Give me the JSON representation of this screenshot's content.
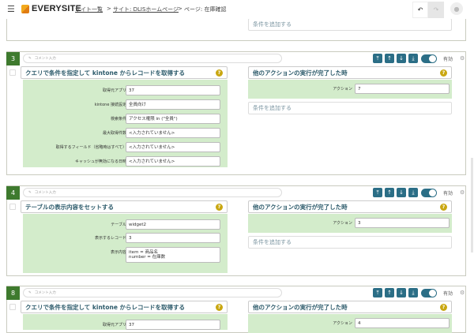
{
  "header": {
    "logo": "EVERYSITE",
    "breadcrumbs": [
      "サイト一覧",
      "サイト: DLISホームページ",
      "ページ: 在庫確認"
    ],
    "separator": ">"
  },
  "common": {
    "comment_placeholder": "コメント入力",
    "enabled_label": "有効",
    "add_condition": "条件を追加する",
    "help": "?"
  },
  "top_partial": {
    "add_condition": "条件を追加する"
  },
  "cards": [
    {
      "number": "3",
      "enabled": true,
      "action": {
        "title": "クエリで条件を指定して kintone からレコードを取得する",
        "fields": [
          {
            "label": "取得元アプリ",
            "value": "37"
          },
          {
            "label": "kintone 接続設定",
            "value": "全員向け"
          },
          {
            "label": "検索条件",
            "value": "アクセス権限 in (\"全員\")"
          },
          {
            "label": "最大取得件数",
            "value": "<入力されていません>"
          },
          {
            "label": "取得するフィールド（省略時はすべて）",
            "value": "<入力されていません>"
          },
          {
            "label": "キャッシュが無効になる日時",
            "value": "<入力されていません>"
          }
        ]
      },
      "trigger": {
        "title": "他のアクションの実行が完了した時",
        "label": "アクション",
        "value": "7"
      }
    },
    {
      "number": "4",
      "enabled": true,
      "action": {
        "title": "テーブルの表示内容をセットする",
        "fields": [
          {
            "label": "テーブル",
            "value": "widget2"
          },
          {
            "label": "表示するレコード",
            "value": "3"
          },
          {
            "label": "表示内容",
            "value": "item = 商品名\nnumber = 在庫数"
          }
        ]
      },
      "trigger": {
        "title": "他のアクションの実行が完了した時",
        "label": "アクション",
        "value": "3"
      }
    },
    {
      "number": "8",
      "enabled": true,
      "action": {
        "title": "クエリで条件を指定して kintone からレコードを取得する",
        "fields": [
          {
            "label": "取得元アプリ",
            "value": "37"
          }
        ]
      },
      "trigger": {
        "title": "他のアクションの実行が完了した時",
        "label": "アクション",
        "value": "4"
      }
    }
  ],
  "colors": {
    "accent": "#2b6e86",
    "number_badge": "#3e7a2e",
    "panel_green": "#d3eccb",
    "help": "#c9a711"
  }
}
